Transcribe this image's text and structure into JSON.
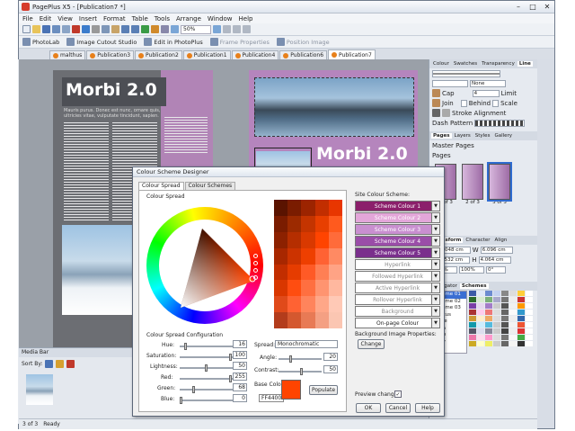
{
  "window": {
    "title": "PagePlus X5 - [Publication7 *]"
  },
  "menu": [
    "File",
    "Edit",
    "View",
    "Insert",
    "Format",
    "Table",
    "Tools",
    "Arrange",
    "Window",
    "Help"
  ],
  "toolbar": {
    "zoom": "50%"
  },
  "toolbar2": {
    "items": [
      {
        "label": "PhotoLab",
        "dis": false
      },
      {
        "label": "Image Cutout Studio",
        "dis": false
      },
      {
        "label": "Edit in PhotoPlus",
        "dis": false
      },
      {
        "label": "Frame Properties",
        "dis": true
      },
      {
        "label": "Position Image",
        "dis": true
      }
    ]
  },
  "doc_tabs": [
    "malthus",
    "Publication3",
    "Publication2",
    "Publication1",
    "Publication4",
    "Publication6",
    "Publication7"
  ],
  "canvas": {
    "left_title": "Morbi 2.0",
    "left_lead": "Mauris purus. Donec est nunc, ornare quis, ultricies vitae, vulputate tincidunt, sapien.",
    "right_title": "Morbi 2.0"
  },
  "right_panel": {
    "tabs_top": [
      "Colour",
      "Swatches",
      "Transparency",
      "Line"
    ],
    "none_label": "None",
    "cap_label": "Cap",
    "cap_value": "4",
    "limit_label": "Limit",
    "join_label": "Join",
    "behind_label": "Behind",
    "scale_label": "Scale",
    "stroke_label": "Stroke Alignment",
    "dash_label": "Dash Pattern",
    "pages_tabs": [
      "Pages",
      "Layers",
      "Styles",
      "Gallery"
    ],
    "master_pages": "Master Pages",
    "pages_label": "Pages",
    "page_thumbs": [
      "1 of 3",
      "2 of 3",
      "3 of 3"
    ],
    "transform_tabs": [
      "Transform",
      "Character",
      "Align"
    ],
    "transform": {
      "x": "4.048 cm",
      "y": "9.532 cm",
      "w": "6.096 cm",
      "h": "4.064 cm",
      "sx": "100%",
      "sy": "100%",
      "rot": "0°"
    },
    "nav_tabs": [
      "Navigator",
      "Schemes"
    ],
    "schemes": [
      "Scheme 01",
      "Scheme 02",
      "Scheme 03",
      "Abacus",
      "Apple",
      "Aqua",
      "Astro",
      "Baby",
      "Bee"
    ]
  },
  "media_bar": {
    "title": "Media Bar",
    "sort_label": "Sort By:"
  },
  "status": {
    "page": "3 of 3",
    "text": "Ready"
  },
  "dialog": {
    "title": "Colour Scheme Designer",
    "tabs": [
      "Colour Spread",
      "Colour Schemes"
    ],
    "spread_label": "Colour Spread",
    "config_label": "Colour Spread Configuration",
    "hue_label": "Hue:",
    "hue": "16",
    "sat_label": "Saturation:",
    "sat": "100",
    "light_label": "Lightness:",
    "light": "50",
    "red_label": "Red:",
    "red": "255",
    "green_label": "Green:",
    "green": "68",
    "blue_label": "Blue:",
    "blue": "0",
    "spread_mode_label": "Spread:",
    "spread_mode": "Monochromatic",
    "angle_label": "Angle:",
    "angle": "20",
    "contrast_label": "Contrast:",
    "contrast": "50",
    "base_label": "Base Colour:",
    "base_hex": "FF4400",
    "base_color": "#ff4400",
    "populate": "Populate",
    "site_label": "Site Colour Scheme:",
    "scheme_rows": [
      {
        "label": "Scheme Colour 1",
        "bg": "#8b1f6b",
        "fg": "#fff"
      },
      {
        "label": "Scheme Colour 2",
        "bg": "#e3a6d9",
        "fg": "#fff"
      },
      {
        "label": "Scheme Colour 3",
        "bg": "#c98fd0",
        "fg": "#fff"
      },
      {
        "label": "Scheme Colour 4",
        "bg": "#9a4da8",
        "fg": "#fff"
      },
      {
        "label": "Scheme Colour 5",
        "bg": "#7a2f8c",
        "fg": "#fff"
      },
      {
        "label": "Hyperlink",
        "bg": "#ffffff",
        "fg": "#888"
      },
      {
        "label": "Followed Hyperlink",
        "bg": "#ffffff",
        "fg": "#888"
      },
      {
        "label": "Active Hyperlink",
        "bg": "#ffffff",
        "fg": "#888"
      },
      {
        "label": "Rollover Hyperlink",
        "bg": "#ffffff",
        "fg": "#888"
      },
      {
        "label": "Background",
        "bg": "#ffffff",
        "fg": "#888"
      },
      {
        "label": "On-page Colour",
        "bg": "#ffffff",
        "fg": "#222"
      }
    ],
    "bg_image_label": "Background Image Properties:",
    "change": "Change",
    "preview_label": "Preview changes:",
    "ok": "OK",
    "cancel": "Cancel",
    "help": "Help"
  }
}
